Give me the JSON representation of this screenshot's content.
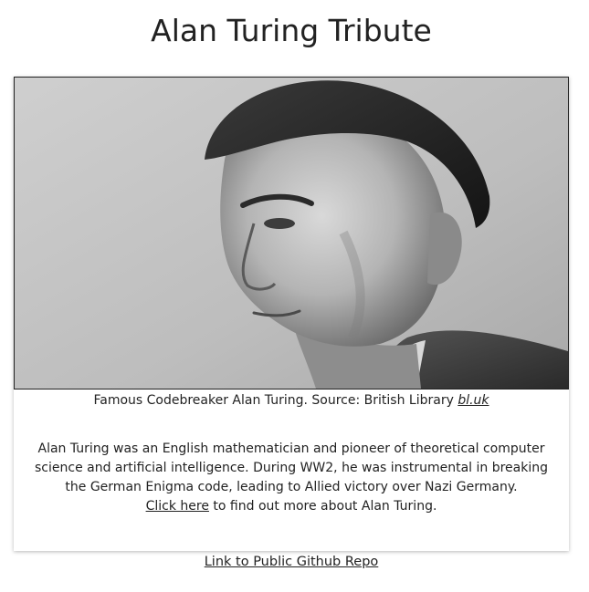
{
  "page": {
    "title": "Alan Turing Tribute"
  },
  "figure": {
    "image_alt": "Portrait of Alan Turing",
    "caption_text": "Famous Codebreaker Alan Turing. Source: British Library",
    "caption_link": "bl.uk"
  },
  "bio": {
    "text": "Alan Turing was an English mathematician and pioneer of theoretical computer science and artificial intelligence. During WW2, he was instrumental in breaking the German Enigma code, leading to Allied victory over Nazi Germany.",
    "more_link": "Click here",
    "more_suffix": "to find out more about Alan Turing."
  },
  "footer": {
    "repo_link": "Link to Public Github Repo"
  },
  "colors": {
    "text": "#222222",
    "background": "#ffffff"
  }
}
